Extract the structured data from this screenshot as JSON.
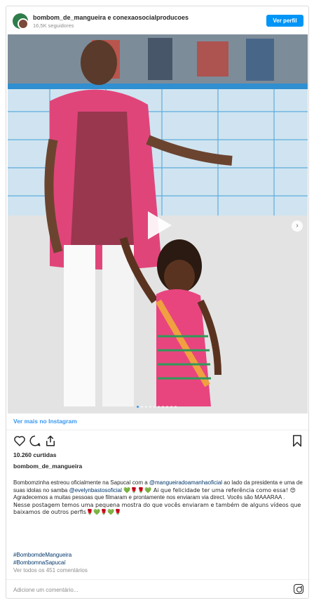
{
  "header": {
    "account_names": "bombom_de_mangueira e conexaosocialproducoes",
    "followers": "16,5K seguidores",
    "profile_button": "Ver perfil"
  },
  "media": {
    "play_icon": "play-icon",
    "next_icon": "chevron-right-icon",
    "slide_count": 10,
    "active_slide": 1
  },
  "view_more": "Ver mais no Instagram",
  "actions": {
    "like_icon": "heart-icon",
    "comment_icon": "comment-icon",
    "share_icon": "share-icon",
    "save_icon": "bookmark-icon"
  },
  "likes": "10.260 curtidas",
  "poster": "bombom_de_mangueira",
  "caption": {
    "line1_a": "Bombomzinha estreou oficialmente na Sapucaí com a ",
    "mention1": "@mangueiradoamanhaoficial",
    "line1_b": " ao lado da presidenta e uma de suas idolas no samba ",
    "mention2": "@evelynbastosoficial",
    "line1_c": " 💚🌹🌹💚 Ai que felicidade ter uma referência como essa! 😍",
    "line2": "Agradecemos a muitas pessoas que filmaram e prontamente nos enviaram via direct. Vocês são MAAARAA .",
    "line3": "Nesse postagem temos uma pequena mostra do que vocês enviaram e também de alguns vídeos que baixamos de outros perfis🌹💚🌹💚🌹"
  },
  "hashtags": [
    "#BombomdeMangueira",
    "#BombomnaSapucaí"
  ],
  "all_comments": "Ver todos os 451 comentários",
  "comment_placeholder": "Adicione um comentário...",
  "colors": {
    "accent": "#0095f6",
    "link": "#3897f0",
    "mention": "#003569",
    "muted": "#8e8e8e"
  }
}
